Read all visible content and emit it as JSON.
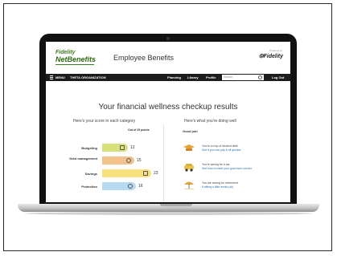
{
  "header": {
    "logo_line1": "Fidelity",
    "logo_line2": "NetBenefits",
    "title": "Employee Benefits",
    "powered_by": "Powered by",
    "brand": "Fidelity"
  },
  "nav": {
    "menu_label": "MENU",
    "org_name": "THETA ORGANIZATION",
    "links": [
      "Planning",
      "Library",
      "Profile"
    ],
    "search_placeholder": "Search",
    "logout_label": "Log Out"
  },
  "page": {
    "title": "Your financial wellness checkup results",
    "left_heading": "Here's your score in each category",
    "out_of": "Out of 25 points",
    "right_heading": "Here's what you're doing well",
    "good_job": "Good job!"
  },
  "scores": [
    {
      "label": "Budgeting",
      "value": 12,
      "icon": "calculator-icon",
      "color": "#d7e07a"
    },
    {
      "label": "Debt management",
      "value": 15,
      "icon": "percent-icon",
      "color": "#f2c38c"
    },
    {
      "label": "Savings",
      "value": 23,
      "icon": "safe-icon",
      "color": "#f6e07f"
    },
    {
      "label": "Protection",
      "value": 16,
      "icon": "gear-shield-icon",
      "color": "#b9dbf2"
    }
  ],
  "messages": [
    {
      "title": "You're on top of student debt.",
      "link": "See if you can pay it off quicker.",
      "icon": "graduation-cap-icon"
    },
    {
      "title": "You're saving for a car.",
      "link": "See how to meet your goal even sooner.",
      "icon": "car-icon"
    },
    {
      "title": "You are saving for retirement.",
      "link": "If sitting a little works (ok)",
      "icon": "beach-umbrella-icon"
    }
  ]
}
